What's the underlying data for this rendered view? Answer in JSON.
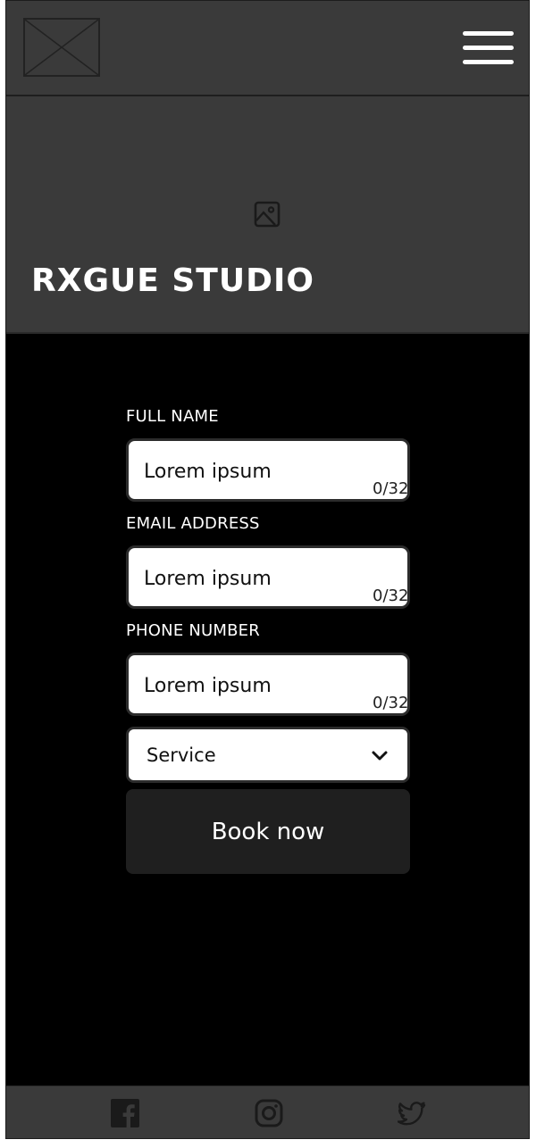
{
  "header": {
    "logo_icon": "image-placeholder-icon",
    "menu_icon": "hamburger-menu-icon"
  },
  "hero": {
    "image_icon": "image-icon",
    "title": "RXGUE STUDIO"
  },
  "form": {
    "fields": [
      {
        "label": "FULL NAME",
        "placeholder": "Lorem ipsum",
        "value": "",
        "counter": "0/32"
      },
      {
        "label": "EMAIL ADDRESS",
        "placeholder": "Lorem ipsum",
        "value": "",
        "counter": "0/32"
      },
      {
        "label": "PHONE NUMBER",
        "placeholder": "Lorem ipsum",
        "value": "",
        "counter": "0/32"
      }
    ],
    "service_select": {
      "selected": "Service",
      "icon": "chevron-down-icon"
    },
    "submit_label": "Book now"
  },
  "footer": {
    "social": [
      "facebook-icon",
      "instagram-icon",
      "twitter-icon"
    ]
  },
  "colors": {
    "page_background": "#000000",
    "header_background": "#3a3a3a",
    "button_background": "#1f1f1f",
    "input_background": "#ffffff",
    "text_light": "#ffffff"
  }
}
